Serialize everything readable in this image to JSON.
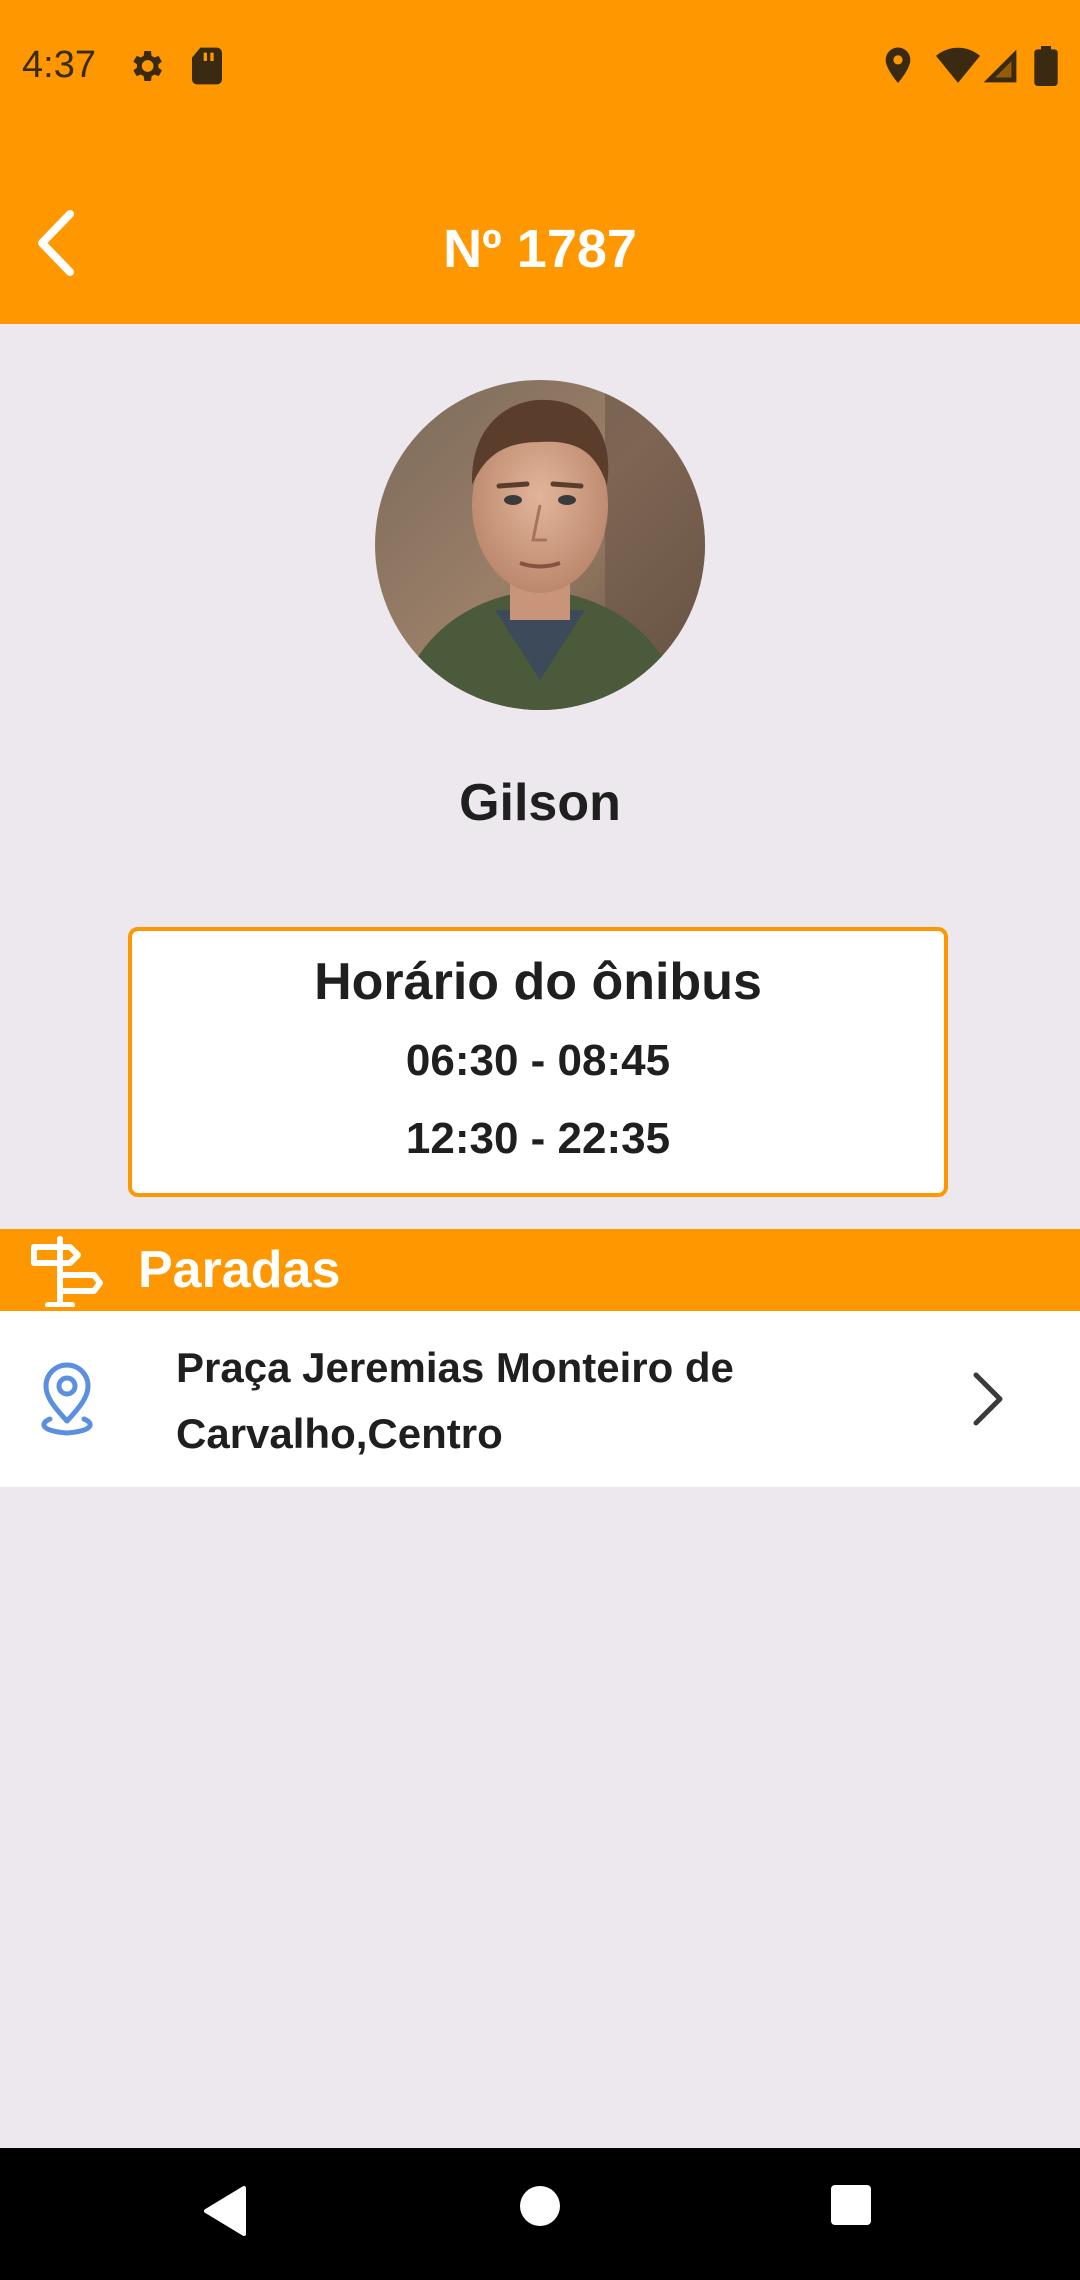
{
  "status_bar": {
    "time": "4:37",
    "icons": [
      "gear-icon",
      "sd-card-icon",
      "location-icon",
      "wifi-icon",
      "cell-signal-icon",
      "battery-icon"
    ]
  },
  "app_bar": {
    "title": "Nº 1787",
    "back_icon": "chevron-left-icon"
  },
  "driver": {
    "name": "Gilson"
  },
  "schedule": {
    "title": "Horário do ônibus",
    "times": [
      "06:30 - 08:45",
      "12:30 - 22:35"
    ]
  },
  "stops": {
    "header_label": "Paradas",
    "header_icon": "signpost-icon",
    "items": [
      {
        "label": "Praça Jeremias Monteiro de Carvalho,Centro",
        "icon": "map-pin-icon",
        "trailing_icon": "chevron-right-icon"
      }
    ]
  },
  "nav_bar": {
    "buttons": [
      "back-triangle-icon",
      "home-circle-icon",
      "recents-square-icon"
    ]
  },
  "colors": {
    "primary": "#ff9800",
    "background": "#ede7ee",
    "pin_blue": "#5b8fe0"
  }
}
